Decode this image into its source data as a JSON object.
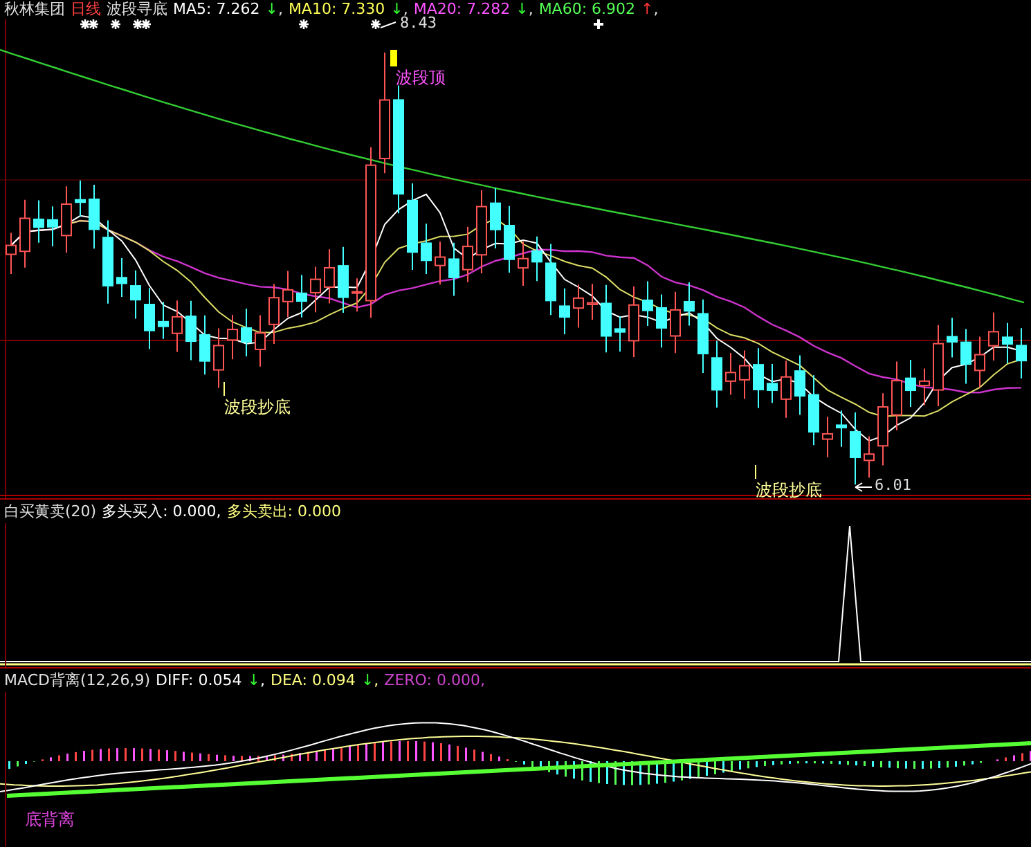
{
  "main": {
    "stock": "秋林集团",
    "period": "日线",
    "indicator": "波段寻底",
    "ma": [
      {
        "label": "MA5: 7.262",
        "arrow": {
          "text": "↓",
          "color": "#33ff33"
        },
        "suffix": ",",
        "color": "#ffffff"
      },
      {
        "label": "MA10: 7.330",
        "arrow": {
          "text": "↓",
          "color": "#33ff33"
        },
        "suffix": ",",
        "color": "#ffff55"
      },
      {
        "label": "MA20: 7.282",
        "arrow": {
          "text": "↓",
          "color": "#33ff33"
        },
        "suffix": ",",
        "color": "#ff55ff"
      },
      {
        "label": "MA60: 6.902",
        "arrow": {
          "text": "↑",
          "color": "#ff3333"
        },
        "suffix": ",",
        "color": "#55ff55"
      }
    ],
    "high_label": "8.43",
    "low_label": "6.01",
    "signals": [
      {
        "kind": "top",
        "text": "波段顶"
      },
      {
        "kind": "bottom",
        "text": "波段抄底"
      },
      {
        "kind": "bottom",
        "text": "波段抄底"
      }
    ]
  },
  "panel2": {
    "title": "白买黄卖(20)",
    "items": [
      {
        "label": "多头买入: 0.000,",
        "color": "#ffffff"
      },
      {
        "label": "多头卖出: 0.000",
        "color": "#ffff80"
      }
    ]
  },
  "macd": {
    "title": "MACD背离(12,26,9)",
    "items": [
      {
        "label": "DIFF: 0.054",
        "arrow": {
          "text": "↓",
          "color": "#33ff33"
        },
        "suffix": ",",
        "color": "#ffffff"
      },
      {
        "label": "DEA: 0.094",
        "arrow": {
          "text": "↓",
          "color": "#33ff33"
        },
        "suffix": ",",
        "color": "#ffff80"
      },
      {
        "label": "ZERO: 0.000",
        "suffix": ",",
        "color": "#cc44cc"
      }
    ],
    "signal": "底背离"
  }
}
